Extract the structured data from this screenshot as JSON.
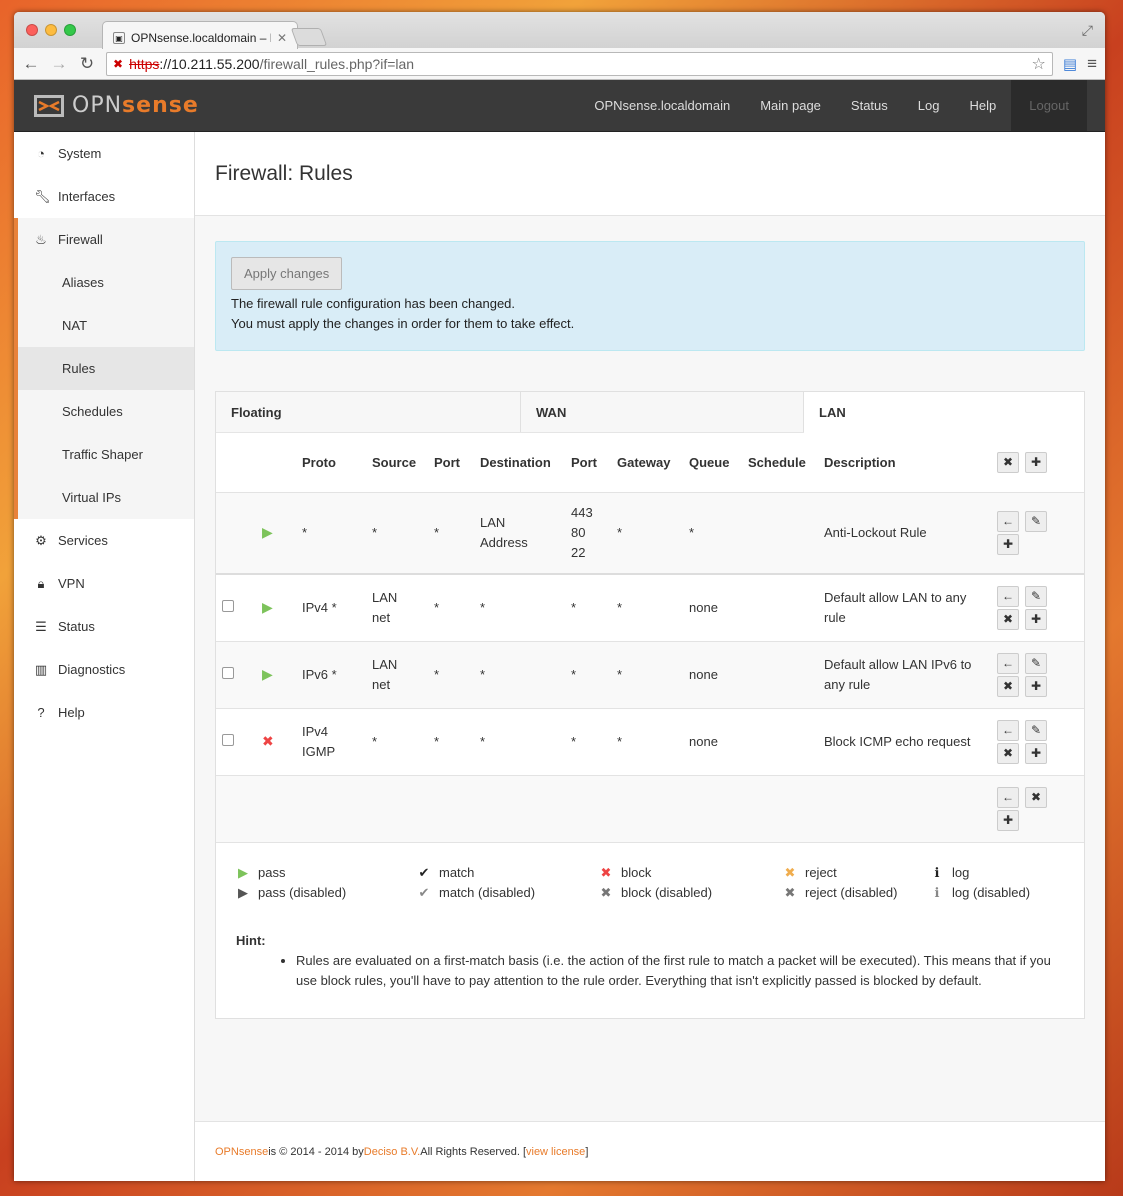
{
  "browser": {
    "tab_title": "OPNsense.localdomain – F",
    "url_scheme": "https",
    "url_host": "://10.211.55.200",
    "url_path": "/firewall_rules.php?if=lan"
  },
  "header": {
    "logo_opn": "OPN",
    "logo_sense": "sense",
    "nav": [
      "OPNsense.localdomain",
      "Main page",
      "Status",
      "Log",
      "Help",
      "Logout"
    ]
  },
  "sidebar": {
    "items": [
      {
        "label": "System",
        "icon": "dashboard-icon"
      },
      {
        "label": "Interfaces",
        "icon": "wrench-icon"
      },
      {
        "label": "Firewall",
        "icon": "fire-icon"
      },
      {
        "label": "Services",
        "icon": "gear-icon"
      },
      {
        "label": "VPN",
        "icon": "lock-icon"
      },
      {
        "label": "Status",
        "icon": "tasks-icon"
      },
      {
        "label": "Diagnostics",
        "icon": "chart-icon"
      },
      {
        "label": "Help",
        "icon": "question-icon"
      }
    ],
    "firewall_sub": [
      "Aliases",
      "NAT",
      "Rules",
      "Schedules",
      "Traffic Shaper",
      "Virtual IPs"
    ]
  },
  "page": {
    "title": "Firewall: Rules",
    "apply_button": "Apply changes",
    "alert_line1": "The firewall rule configuration has been changed.",
    "alert_line2": "You must apply the changes in order for them to take effect."
  },
  "tabs": [
    "Floating",
    "WAN",
    "LAN"
  ],
  "columns": [
    "Proto",
    "Source",
    "Port",
    "Destination",
    "Port",
    "Gateway",
    "Queue",
    "Schedule",
    "Description"
  ],
  "lockout": {
    "proto": "*",
    "source": "*",
    "port": "*",
    "destination_l1": "LAN",
    "destination_l2": "Address",
    "dport_l1": "443",
    "dport_l2": "80",
    "dport_l3": "22",
    "gateway": "*",
    "queue": "*",
    "schedule": "",
    "description": "Anti-Lockout Rule"
  },
  "rules": [
    {
      "action": "pass",
      "proto_l1": "IPv4 *",
      "proto_l2": "",
      "source_l1": "LAN",
      "source_l2": "net",
      "port": "*",
      "destination": "*",
      "dport": "*",
      "gateway": "*",
      "queue": "none",
      "schedule": "",
      "desc_l1": "Default allow LAN to any",
      "desc_l2": "rule"
    },
    {
      "action": "pass",
      "proto_l1": "IPv6 *",
      "proto_l2": "",
      "source_l1": "LAN",
      "source_l2": "net",
      "port": "*",
      "destination": "*",
      "dport": "*",
      "gateway": "*",
      "queue": "none",
      "schedule": "",
      "desc_l1": "Default allow LAN IPv6 to",
      "desc_l2": "any rule"
    },
    {
      "action": "block",
      "proto_l1": "IPv4",
      "proto_l2": "IGMP",
      "source_l1": "*",
      "source_l2": "",
      "port": "*",
      "destination": "*",
      "dport": "*",
      "gateway": "*",
      "queue": "none",
      "schedule": "",
      "desc_l1": "Block ICMP echo request",
      "desc_l2": ""
    }
  ],
  "legend": {
    "pass": "pass",
    "pass_disabled": "pass (disabled)",
    "match": "match",
    "match_disabled": "match (disabled)",
    "block": "block",
    "block_disabled": "block (disabled)",
    "reject": "reject",
    "reject_disabled": "reject (disabled)",
    "log": "log",
    "log_disabled": "log (disabled)"
  },
  "hint": {
    "title": "Hint:",
    "text": "Rules are evaluated on a first-match basis (i.e. the action of the first rule to match a packet will be executed). This means that if you use block rules, you'll have to pay attention to the rule order. Everything that isn't explicitly passed is blocked by default."
  },
  "footer": {
    "brand": "OPNsense",
    "text1": " is © 2014 - 2014 by ",
    "company": "Deciso B.V.",
    "text2": " All Rights Reserved. [",
    "license": "view license",
    "text3": "]"
  },
  "colors": {
    "accent": "#e87b2a",
    "pass": "#7dc35b",
    "block": "#e44444",
    "alert_bg": "#d9edf7"
  }
}
